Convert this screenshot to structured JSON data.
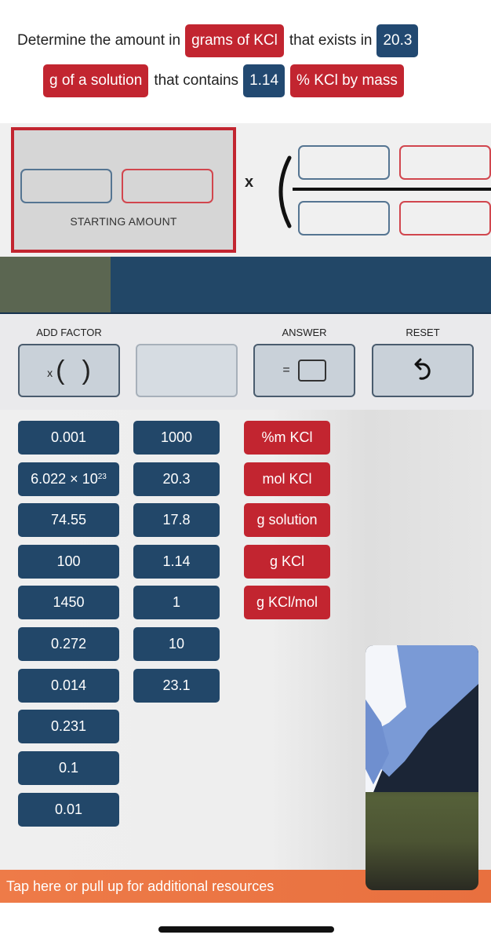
{
  "question": {
    "line1": [
      {
        "type": "text",
        "value": "Determine the amount in"
      },
      {
        "type": "chip",
        "color": "red",
        "value": "grams of KCl"
      },
      {
        "type": "text",
        "value": "that exists in"
      },
      {
        "type": "chip",
        "color": "blue",
        "value": "20.3"
      }
    ],
    "line2": [
      {
        "type": "chip",
        "color": "red",
        "value": "g of a solution"
      },
      {
        "type": "text",
        "value": "that contains"
      },
      {
        "type": "chip",
        "color": "blue",
        "value": "1.14"
      },
      {
        "type": "chip",
        "color": "red",
        "value": "% KCl by mass"
      }
    ]
  },
  "equation": {
    "starting_amount_label": "STARTING AMOUNT",
    "times_symbol": "x",
    "starting_value": "",
    "starting_unit": "",
    "factor": {
      "numerator_value": "",
      "numerator_unit": "",
      "denominator_value": "",
      "denominator_unit": ""
    }
  },
  "toolbar": {
    "add_factor_label": "ADD FACTOR",
    "add_factor_glyph_x": "x",
    "add_factor_open": "(",
    "add_factor_close": ")",
    "answer_label": "ANSWER",
    "answer_eq": "=",
    "reset_label": "RESET",
    "reset_icon": "↺"
  },
  "tiles": {
    "numbers_col1": [
      "0.001",
      "6.022 × 10^23",
      "74.55",
      "100",
      "1450",
      "0.272",
      "0.014",
      "0.231",
      "0.1",
      "0.01"
    ],
    "numbers_col2": [
      "1000",
      "20.3",
      "17.8",
      "1.14",
      "1",
      "10",
      "23.1"
    ],
    "units": [
      "%m KCl",
      "mol KCl",
      "g solution",
      "g KCl",
      "g KCl/mol"
    ]
  },
  "resources": {
    "label": "Tap here or pull up for additional resources"
  },
  "colors": {
    "red": "#c22530",
    "blue": "#224769",
    "orange": "#ee7b48",
    "olive": "#5b6651"
  }
}
